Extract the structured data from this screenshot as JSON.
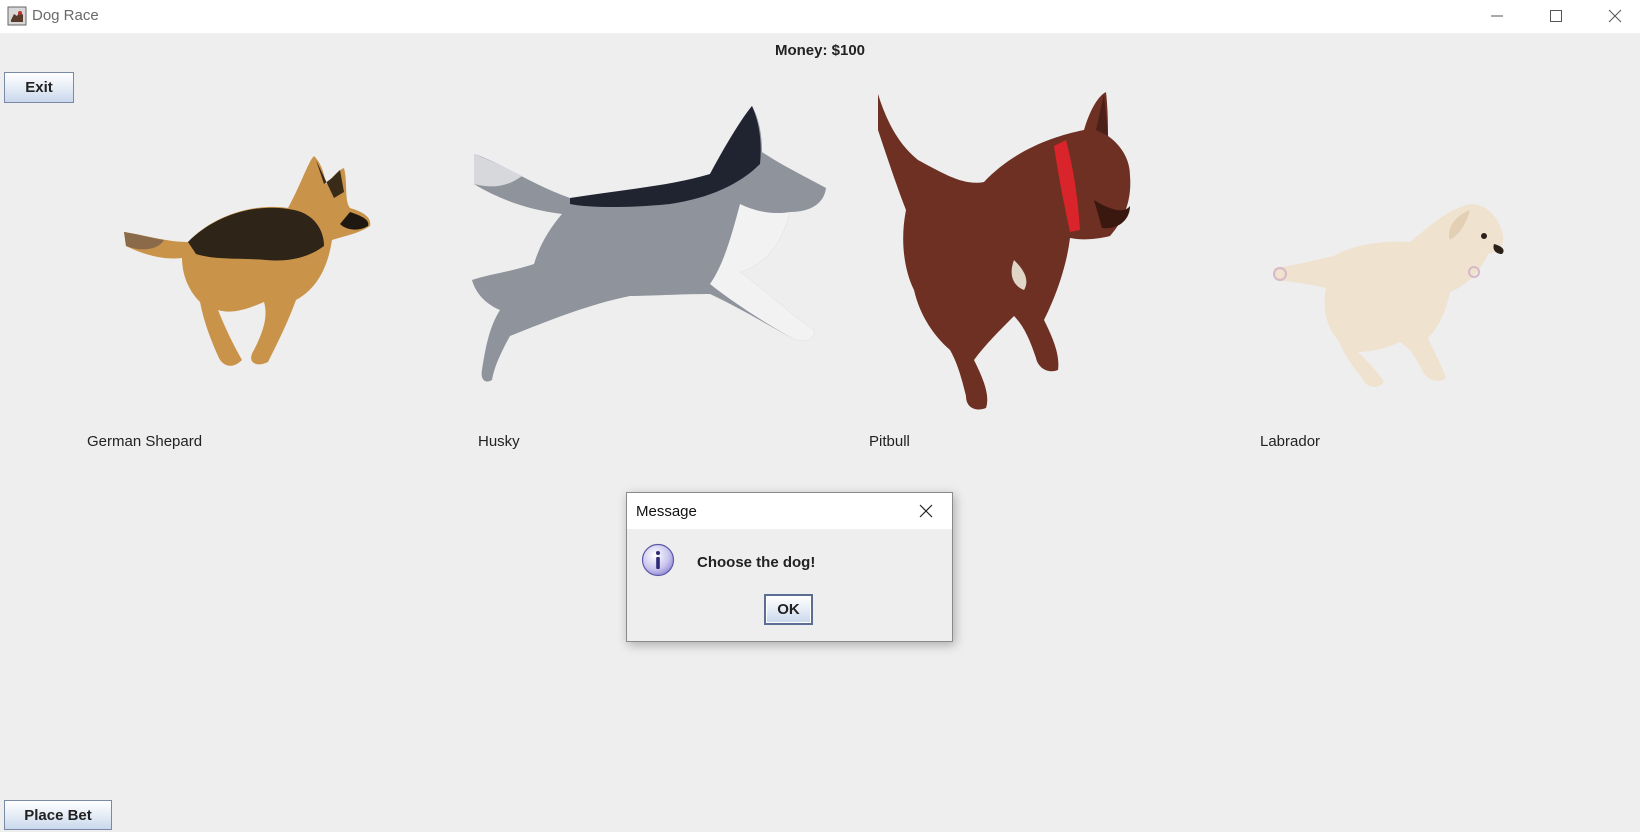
{
  "window": {
    "title": "Dog Race",
    "app_icon": "dog-race-app-icon",
    "controls": [
      "minimize-icon",
      "maximize-icon",
      "close-icon"
    ]
  },
  "header": {
    "money_label": "Money:",
    "money_value": "$100"
  },
  "buttons": {
    "exit_label": "Exit",
    "place_bet_label": "Place Bet"
  },
  "dogs": [
    {
      "name": "German Shepard",
      "image": "german-shepherd-running-photo"
    },
    {
      "name": "Husky",
      "image": "husky-running-photo"
    },
    {
      "name": "Pitbull",
      "image": "pitbull-running-photo"
    },
    {
      "name": "Labrador",
      "image": "labrador-running-photo"
    }
  ],
  "dialog": {
    "title": "Message",
    "message": "Choose the dog!",
    "ok_label": "OK",
    "icon": "information-icon"
  },
  "colors": {
    "window_bg": "#eeeeee",
    "titlebar_bg": "#ffffff",
    "button_border": "#7a8aa6"
  }
}
